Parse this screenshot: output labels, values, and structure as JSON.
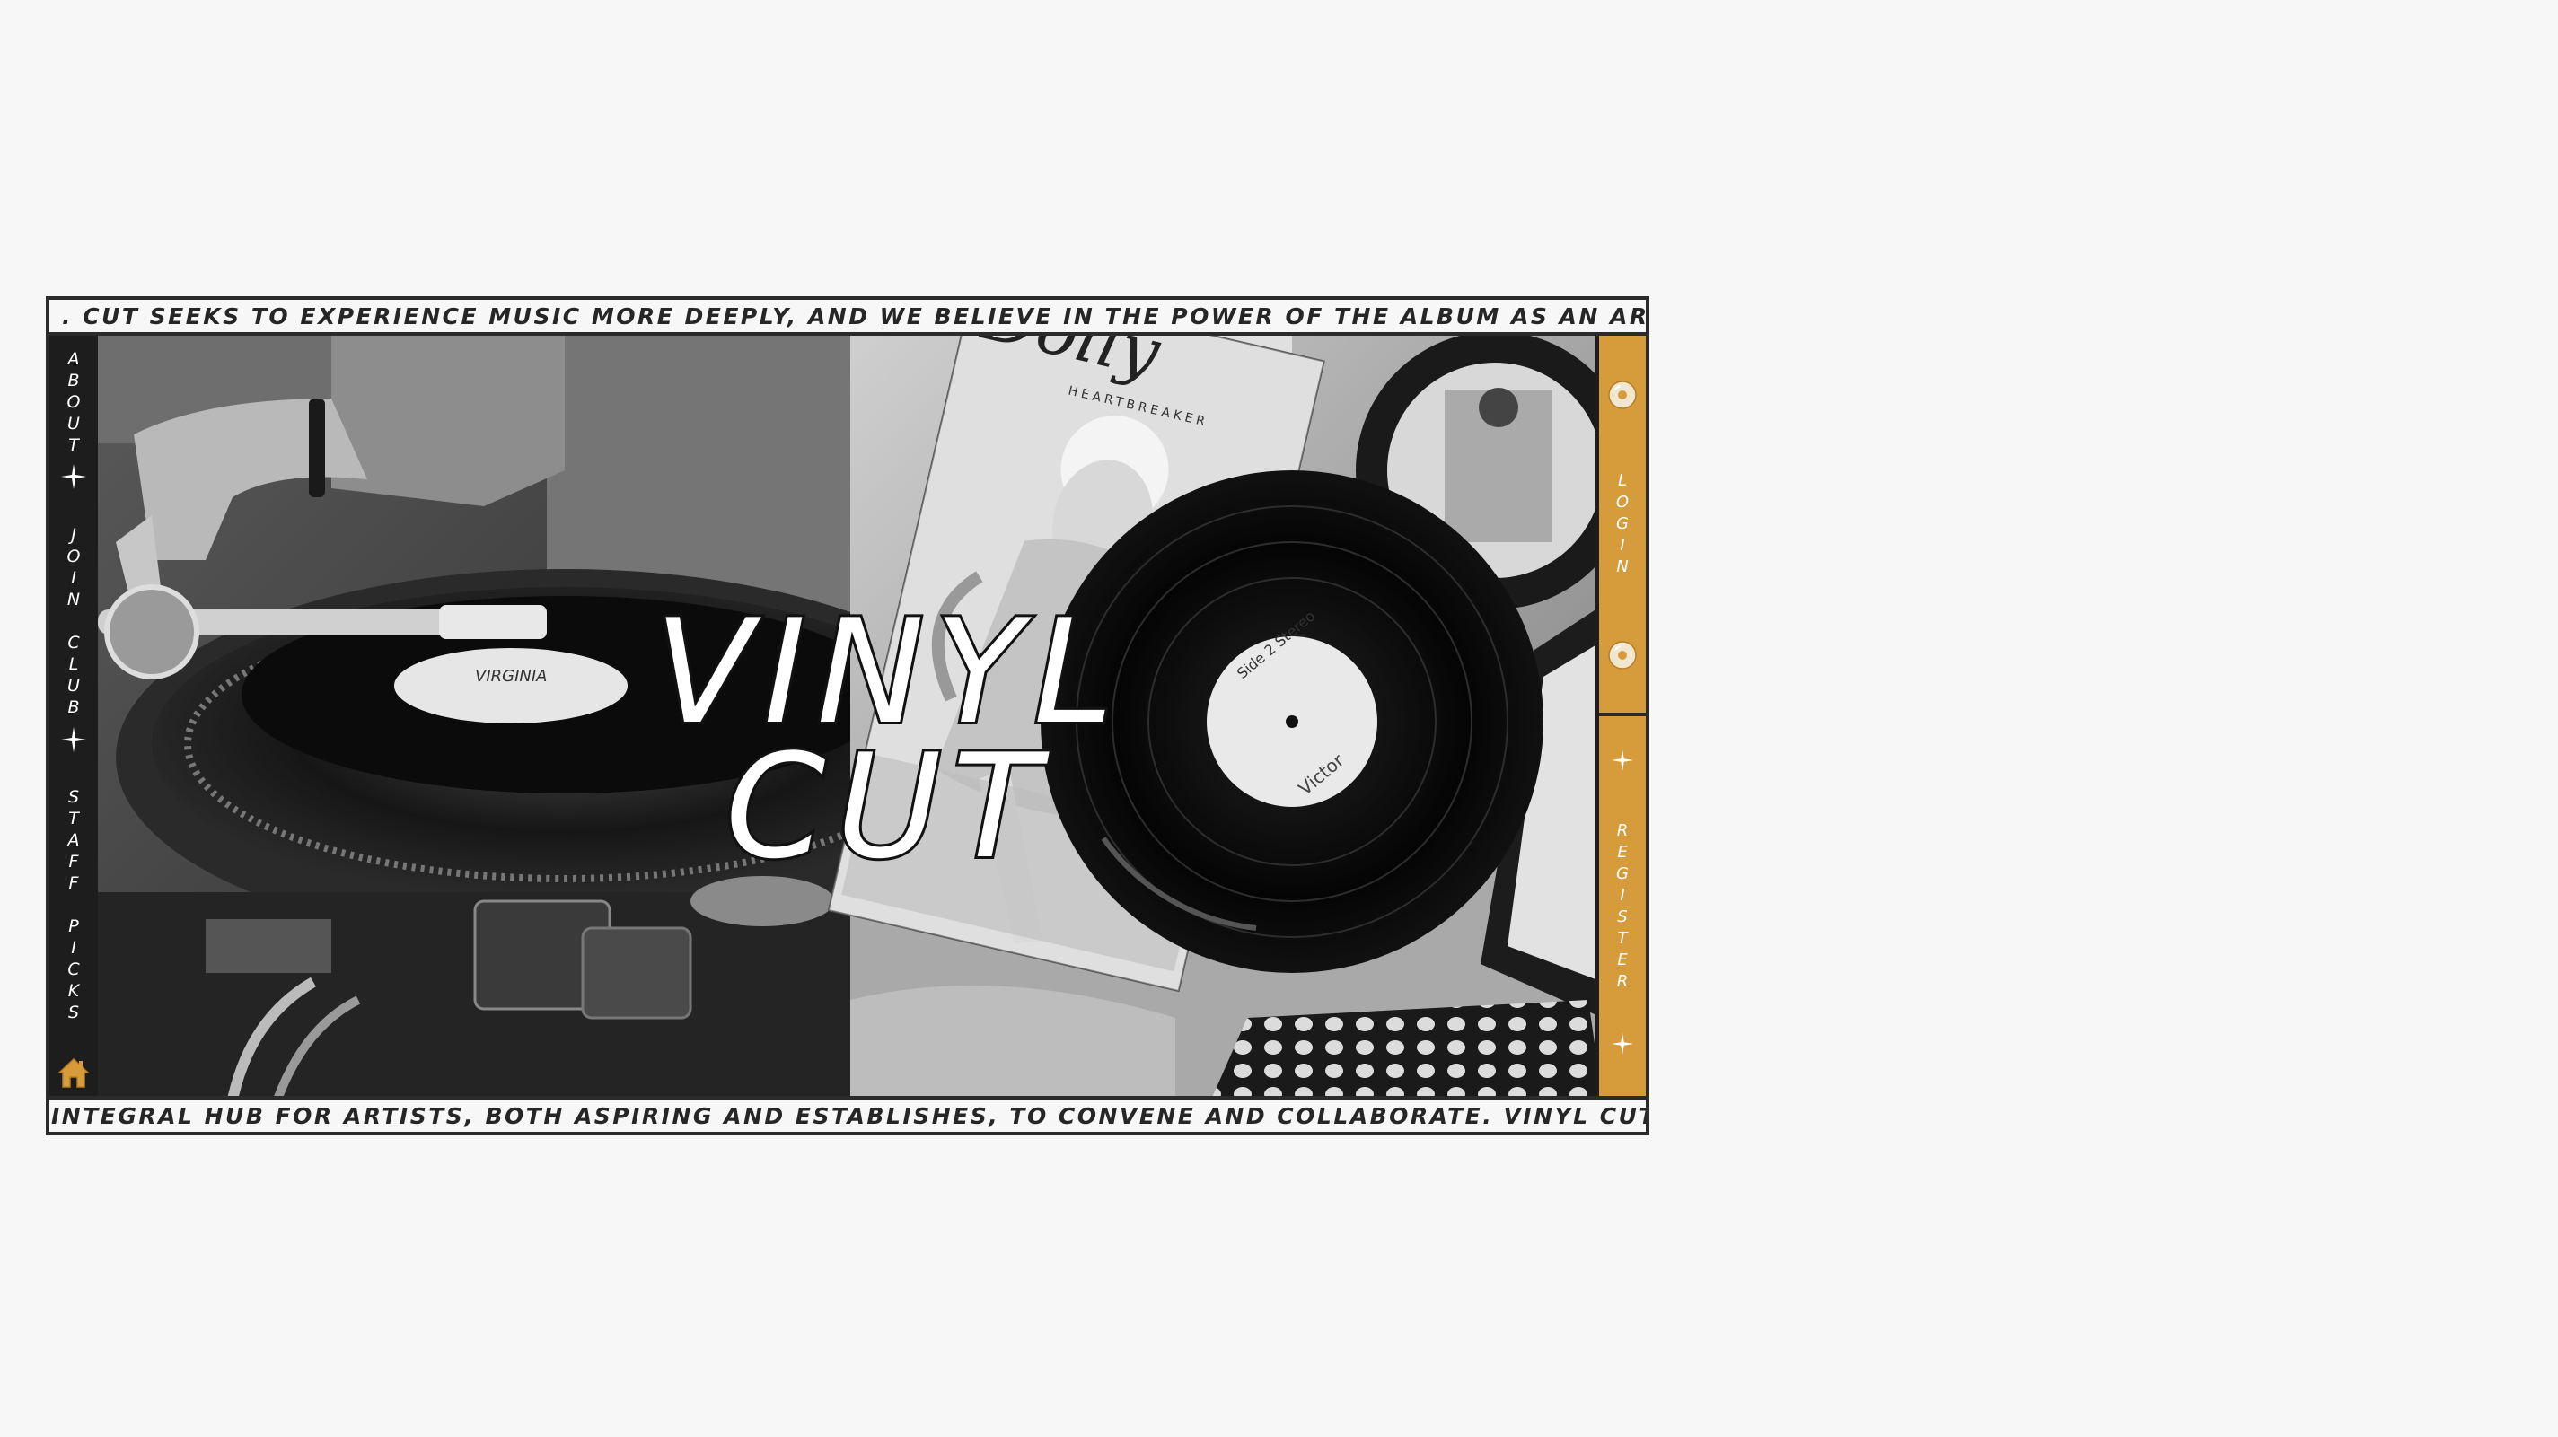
{
  "ticker_top": "CUT SEEKS TO EXPERIENCE MUSIC MORE DEEPLY, AND WE BELIEVE IN THE POWER OF THE ALBUM AS AN ART FORM. VINYL CU",
  "ticker_top_lead": ".",
  "ticker_bottom": "INTEGRAL HUB FOR ARTISTS, BOTH ASPIRING AND ESTABLISHES, TO CONVENE AND COLLABORATE. VINYL CUT BEGAN AS A SM",
  "nav_left": {
    "about": "A\nB\nO\nU\nT",
    "join_club": "J\nO\nI\nN\n\nC\nL\nU\nB",
    "staff_picks": "S\nT\nA\nF\nF\n\nP\nI\nC\nK\nS",
    "home_icon": "home-icon"
  },
  "hero": {
    "title_line1": "VINYL",
    "title_line2": "CUT",
    "record_label_side": "Side 2 Stereo",
    "record_label_brand": "Victor",
    "album_script": "Dolly",
    "album_sub": "HEARTBREAKER"
  },
  "nav_right": {
    "login": "L\nO\nG\nI\nN",
    "register": "R\nE\nG\nI\nS\nT\nE\nR"
  },
  "colors": {
    "accent": "#d69c3b",
    "dark": "#1d1d1d",
    "background": "#f7f7f7"
  }
}
